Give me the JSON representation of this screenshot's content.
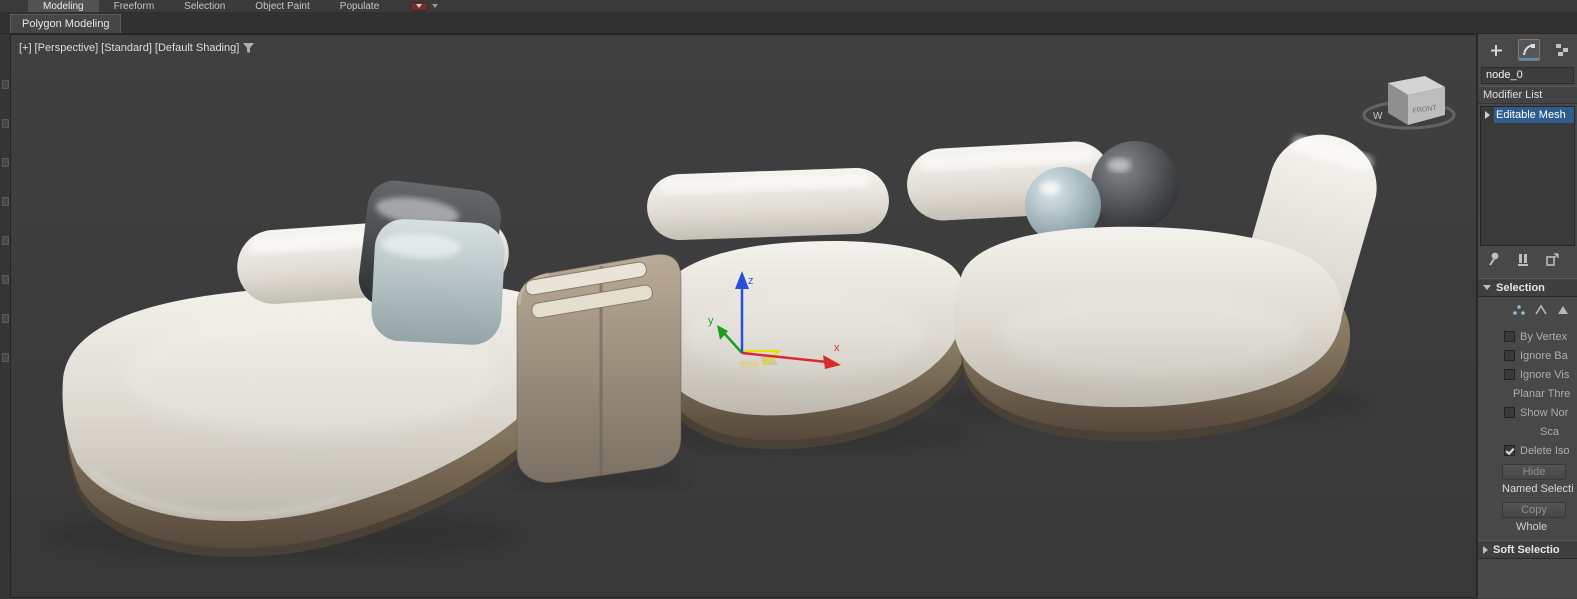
{
  "colors": {
    "accent_blue": "#2e5c8c",
    "viewport_bg": "#3b3b3b",
    "panel_bg": "#484848",
    "gizmo_x": "#d92b2b",
    "gizmo_y": "#1f9e1f",
    "gizmo_z": "#2a4fd9",
    "gizmo_plane": "#e8e000",
    "sofa_white": "#e6e3db",
    "base_brown": "#8a7c6b",
    "table_tan": "#a59684"
  },
  "ribbon": {
    "tabs": [
      {
        "label": "Modeling",
        "active": true
      },
      {
        "label": "Freeform",
        "active": false
      },
      {
        "label": "Selection",
        "active": false
      },
      {
        "label": "Object Paint",
        "active": false
      },
      {
        "label": "Populate",
        "active": false
      }
    ],
    "panel_tab": "Polygon Modeling"
  },
  "viewport": {
    "label_segments": [
      "[+]",
      "[Perspective]",
      "[Standard]",
      "[Default Shading]"
    ],
    "gizmo_labels": {
      "x": "x",
      "y": "y",
      "z": "z"
    },
    "viewcube": {
      "front_label": "FRONT",
      "west_label": "W"
    }
  },
  "command_panel": {
    "object_name": "node_0",
    "modifier_dropdown": "Modifier List",
    "stack_items": [
      {
        "label": "Editable Mesh",
        "selected": true
      }
    ],
    "selection_rollout": {
      "title": "Selection",
      "items": [
        {
          "type": "checkbox",
          "label": "By Vertex",
          "checked": false
        },
        {
          "type": "checkbox",
          "label": "Ignore Ba",
          "checked": false
        },
        {
          "type": "checkbox",
          "label": "Ignore Vis",
          "checked": false
        },
        {
          "type": "label",
          "label": "Planar Thre"
        },
        {
          "type": "checkbox",
          "label": "Show Nor",
          "checked": false
        },
        {
          "type": "label",
          "label": "Sca"
        },
        {
          "type": "checkbox",
          "label": "Delete Iso",
          "checked": true
        }
      ],
      "hide_button": "Hide",
      "named_selections_label": "Named Selecti",
      "copy_button": "Copy",
      "whole_label": "Whole"
    },
    "soft_selection_rollout": "Soft Selectio"
  }
}
